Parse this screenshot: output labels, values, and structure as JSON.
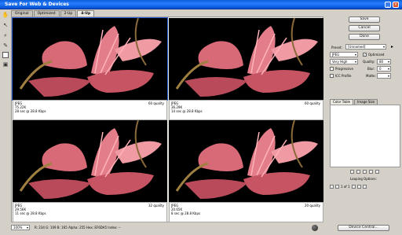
{
  "window": {
    "title": "Save For Web & Devices"
  },
  "tabs": [
    "Original",
    "Optimized",
    "2-Up",
    "4-Up"
  ],
  "panes": [
    {
      "format": "JPEG",
      "size": "75.22K",
      "time": "28 sec @ 28.8 Kbps",
      "quality": "60 quality"
    },
    {
      "format": "JPEG",
      "size": "36.29K",
      "time": "14 sec @ 28.8 Kbps",
      "quality": "60 quality"
    },
    {
      "format": "JPEG",
      "size": "29.56K",
      "time": "11 sec @ 28.8 Kbps",
      "quality": "32 quality"
    },
    {
      "format": "JPEG",
      "size": "20.65K",
      "time": "8 sec @ 28.8 Kbps",
      "quality": "20 quality"
    }
  ],
  "buttons": {
    "save": "Save",
    "cancel": "Cancel",
    "done": "Done",
    "device_central": "Device Central..."
  },
  "settings": {
    "preset_label": "Preset:",
    "preset_value": "[Unnamed]",
    "format": "JPEG",
    "quality_level": "Very High",
    "optimized_label": "Optimized",
    "quality_label": "Quality:",
    "quality_value": "80",
    "progressive_label": "Progressive",
    "icc_label": "ICC Profile",
    "blur_label": "Blur:",
    "blur_value": "0",
    "matte_label": "Matte:"
  },
  "panel_tabs": [
    "Color Table",
    "Image Size"
  ],
  "looping": {
    "label": "Looping Options:",
    "frame_counter": "1 of 1"
  },
  "status": {
    "zoom": "100%",
    "readout": "R: 234   G: 109   B: 165   Alpha: 255   Hex: EF6DA5   Index: --"
  }
}
